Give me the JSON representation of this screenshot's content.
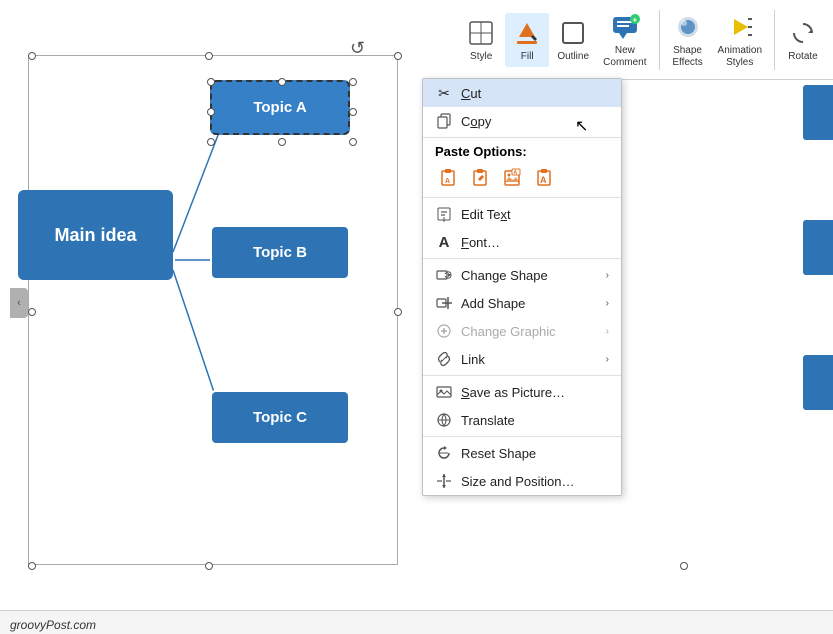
{
  "ribbon": {
    "buttons": [
      {
        "id": "style",
        "label": "Style",
        "icon": "✏️"
      },
      {
        "id": "fill",
        "label": "Fill",
        "icon": "🪣"
      },
      {
        "id": "outline",
        "label": "Outline",
        "icon": "▭"
      },
      {
        "id": "new-comment",
        "label": "New\nComment",
        "icon": "💬"
      },
      {
        "id": "shape-effects",
        "label": "Shape\nEffects",
        "icon": "✨"
      },
      {
        "id": "animation-styles",
        "label": "Animation\nStyles",
        "icon": "▶"
      },
      {
        "id": "rotate",
        "label": "Rotate",
        "icon": "↺"
      }
    ]
  },
  "smartart": {
    "main_label": "Main idea",
    "topics": [
      {
        "id": "topic-a",
        "label": "Topic A"
      },
      {
        "id": "topic-b",
        "label": "Topic B"
      },
      {
        "id": "topic-c",
        "label": "Topic C"
      }
    ]
  },
  "context_menu": {
    "items": [
      {
        "id": "cut",
        "icon": "✂",
        "label": "Cut",
        "highlighted": true,
        "disabled": false,
        "has_arrow": false
      },
      {
        "id": "copy",
        "icon": "📋",
        "label": "Copy",
        "highlighted": false,
        "disabled": false,
        "has_arrow": false
      },
      {
        "id": "paste-options",
        "special": "paste-header",
        "label": "Paste Options:",
        "disabled": false
      },
      {
        "id": "paste-icons",
        "special": "paste-icons",
        "disabled": false
      },
      {
        "id": "edit-text",
        "icon": "A",
        "label": "Edit Text",
        "highlighted": false,
        "disabled": false,
        "has_arrow": false,
        "icon_style": "cursor"
      },
      {
        "id": "font",
        "icon": "A",
        "label": "Font…",
        "highlighted": false,
        "disabled": false,
        "has_arrow": false,
        "underline_char": "F"
      },
      {
        "id": "change-shape",
        "icon": "⬡",
        "label": "Change Shape",
        "highlighted": false,
        "disabled": false,
        "has_arrow": true
      },
      {
        "id": "add-shape",
        "icon": "+",
        "label": "Add Shape",
        "highlighted": false,
        "disabled": false,
        "has_arrow": true
      },
      {
        "id": "change-graphic",
        "icon": "🔗",
        "label": "Change Graphic",
        "highlighted": false,
        "disabled": true,
        "has_arrow": true
      },
      {
        "id": "link",
        "icon": "🔗",
        "label": "Link",
        "highlighted": false,
        "disabled": false,
        "has_arrow": true
      },
      {
        "id": "save-as-picture",
        "icon": "💾",
        "label": "Save as Picture…",
        "highlighted": false,
        "disabled": false,
        "has_arrow": false
      },
      {
        "id": "translate",
        "icon": "🌐",
        "label": "Translate",
        "highlighted": false,
        "disabled": false,
        "has_arrow": false
      },
      {
        "id": "reset-shape",
        "icon": "↺",
        "label": "Reset Shape",
        "highlighted": false,
        "disabled": false,
        "has_arrow": false
      },
      {
        "id": "size-position",
        "icon": "⇕",
        "label": "Size and Position…",
        "highlighted": false,
        "disabled": false,
        "has_arrow": false
      }
    ],
    "paste_icons": [
      "📋",
      "✏️",
      "🖼",
      "A"
    ]
  },
  "status_bar": {
    "watermark": "groovyPost.com"
  }
}
